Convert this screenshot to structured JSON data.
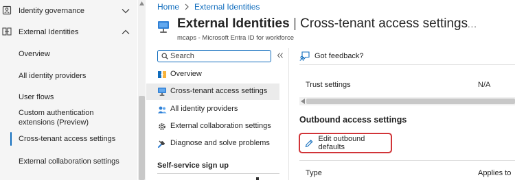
{
  "left_nav": {
    "items": [
      {
        "label": "Identity governance",
        "icon": "identity-governance-icon",
        "chevron": "chevron-down-icon"
      },
      {
        "label": "External Identities",
        "icon": "external-identities-icon",
        "chevron": "chevron-up-icon"
      },
      {
        "label": "Overview"
      },
      {
        "label": "All identity providers"
      },
      {
        "label": "User flows"
      },
      {
        "label": "Custom authentication"
      },
      {
        "label": "extensions (Preview)"
      },
      {
        "label": "Cross-tenant access settings"
      },
      {
        "label": "External collaboration settings"
      }
    ]
  },
  "breadcrumb": {
    "home": "Home",
    "current": "External Identities"
  },
  "header": {
    "title_main": "External Identities",
    "title_sep": "|",
    "title_sub": "Cross-tenant access settings",
    "more": "...",
    "subtitle": "mcaps - Microsoft Entra ID for workforce"
  },
  "search": {
    "placeholder": "Search"
  },
  "resource_menu": {
    "items": [
      {
        "label": "Overview",
        "icon": "overview-icon"
      },
      {
        "label": "Cross-tenant access settings",
        "icon": "cross-tenant-icon",
        "selected": true
      },
      {
        "label": "All identity providers",
        "icon": "identity-providers-icon"
      },
      {
        "label": "External collaboration settings",
        "icon": "gear-icon"
      },
      {
        "label": "Diagnose and solve problems",
        "icon": "wrench-icon"
      }
    ],
    "section_title": "Self-service sign up"
  },
  "main": {
    "feedback_label": "Got feedback?",
    "trust_settings_label": "Trust settings",
    "trust_settings_value": "N/A",
    "outbound_heading": "Outbound access settings",
    "edit_outbound_label": "Edit outbound defaults",
    "table_headers": [
      "Type",
      "Applies to"
    ]
  },
  "colors": {
    "accent": "#0f6cbd",
    "highlight_border": "#d13438",
    "nav_background": "#f5f5f5",
    "selected_background": "#ebebeb"
  }
}
